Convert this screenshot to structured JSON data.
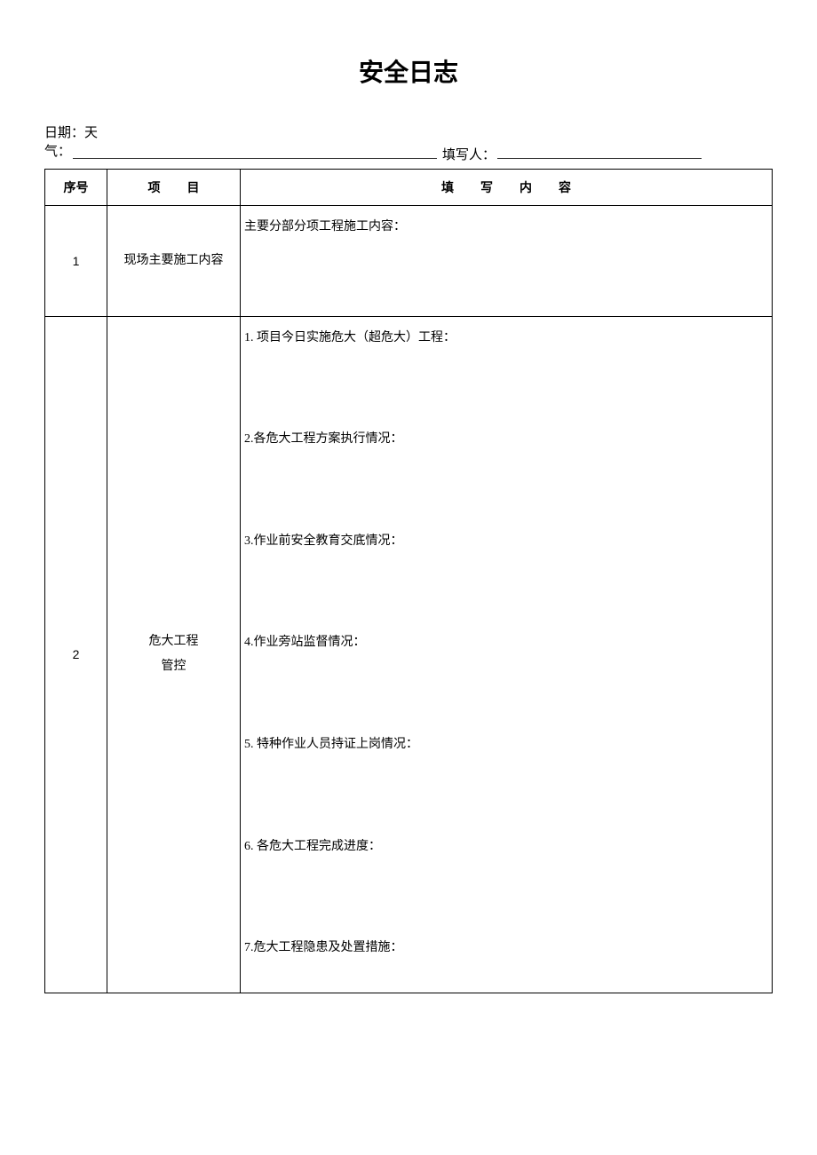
{
  "title": "安全日志",
  "meta": {
    "date_weather_label": "日期：天气：",
    "filler_label": "填写人："
  },
  "headers": {
    "seq": "序号",
    "project": "项目",
    "content": "填写内容"
  },
  "rows": [
    {
      "seq": "1",
      "project": "现场主要施工内容",
      "content_items": [
        "主要分部分项工程施工内容："
      ]
    },
    {
      "seq": "2",
      "project_line1": "危大工程",
      "project_line2": "管控",
      "content_items": [
        "1. 项目今日实施危大（超危大）工程：",
        "2.各危大工程方案执行情况：",
        "3.作业前安全教育交底情况：",
        "4.作业旁站监督情况：",
        "5. 特种作业人员持证上岗情况：",
        "6. 各危大工程完成进度：",
        "7.危大工程隐患及处置措施："
      ]
    }
  ]
}
